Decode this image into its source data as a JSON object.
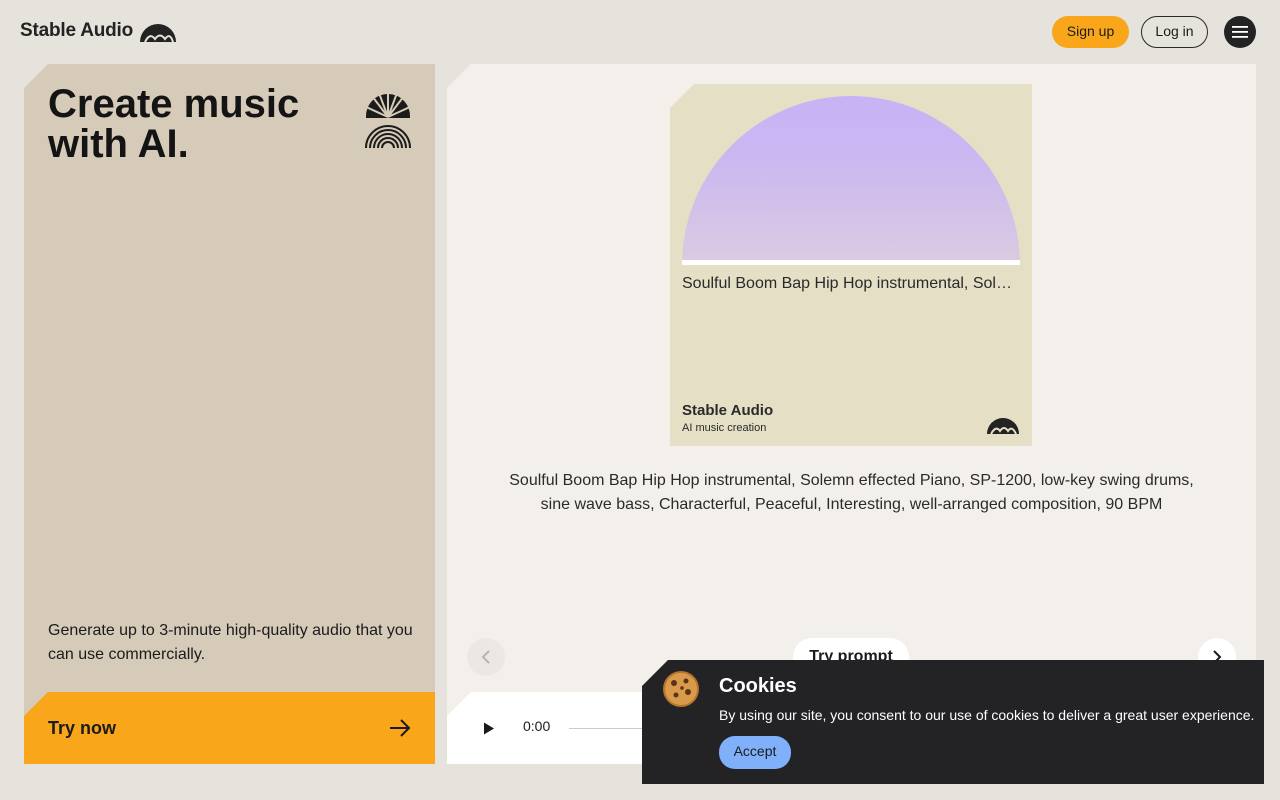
{
  "header": {
    "logo_text": "Stable Audio",
    "signup_label": "Sign up",
    "login_label": "Log in",
    "menu_icon": "hamburger-menu-icon"
  },
  "hero": {
    "title": "Create music with AI.",
    "description": "Generate up to 3-minute high-quality audio that you can use commercially.",
    "cta_label": "Try now",
    "emblem_icon": "sun-rainbow-icon",
    "cta_icon": "arrow-right-icon"
  },
  "showcase": {
    "album_caption": "Soulful Boom Bap Hip Hop instrumental, Sole…",
    "album_brand": "Stable Audio",
    "album_subtitle": "AI music creation",
    "prompt": "Soulful Boom Bap Hip Hop instrumental, Solemn effected Piano, SP-1200, low-key swing drums, sine wave bass, Characterful, Peaceful, Interesting, well-arranged composition, 90 BPM",
    "try_prompt_label": "Try prompt",
    "prev_icon": "chevron-left-icon",
    "next_icon": "chevron-right-icon"
  },
  "player": {
    "current_time": "0:00",
    "play_icon": "play-icon"
  },
  "cookie": {
    "title": "Cookies",
    "message": "By using our site, you consent to our use of cookies to deliver a great user experience.",
    "accept_label": "Accept",
    "icon": "cookie-icon"
  },
  "colors": {
    "background": "#e6e2dc",
    "accent_orange": "#f9a61a",
    "hero_card": "#d5cbb8",
    "panel": "#f3f0eb",
    "album_card": "#e5dfc6",
    "album_art_top": "#c7b3f5",
    "cookie_bg": "#232326",
    "accept_blue": "#7fb0f9"
  }
}
